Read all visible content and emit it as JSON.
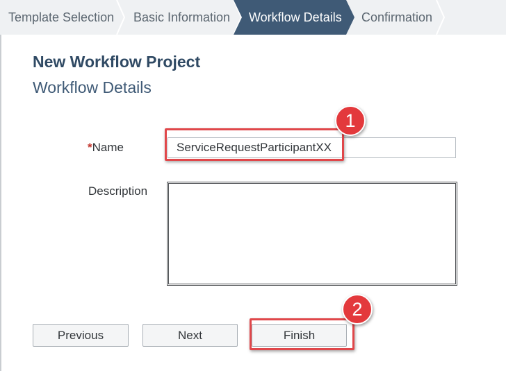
{
  "wizard": {
    "steps": [
      {
        "label": "Template Selection",
        "state": "done"
      },
      {
        "label": "Basic Information",
        "state": "done"
      },
      {
        "label": "Workflow Details",
        "state": "active"
      },
      {
        "label": "Confirmation",
        "state": "pending"
      }
    ]
  },
  "header": {
    "title": "New Workflow Project",
    "subtitle": "Workflow Details"
  },
  "form": {
    "name_label": "Name",
    "required_marker": "*",
    "name_value": "ServiceRequestParticipantXX",
    "description_label": "Description",
    "description_value": ""
  },
  "buttons": {
    "previous": "Previous",
    "next": "Next",
    "finish": "Finish"
  },
  "annotations": {
    "badge_1": "1",
    "badge_2": "2"
  },
  "colors": {
    "active_step": "#3f5a76",
    "title": "#304a64",
    "required": "#c2362e",
    "callout": "#e0474a"
  }
}
